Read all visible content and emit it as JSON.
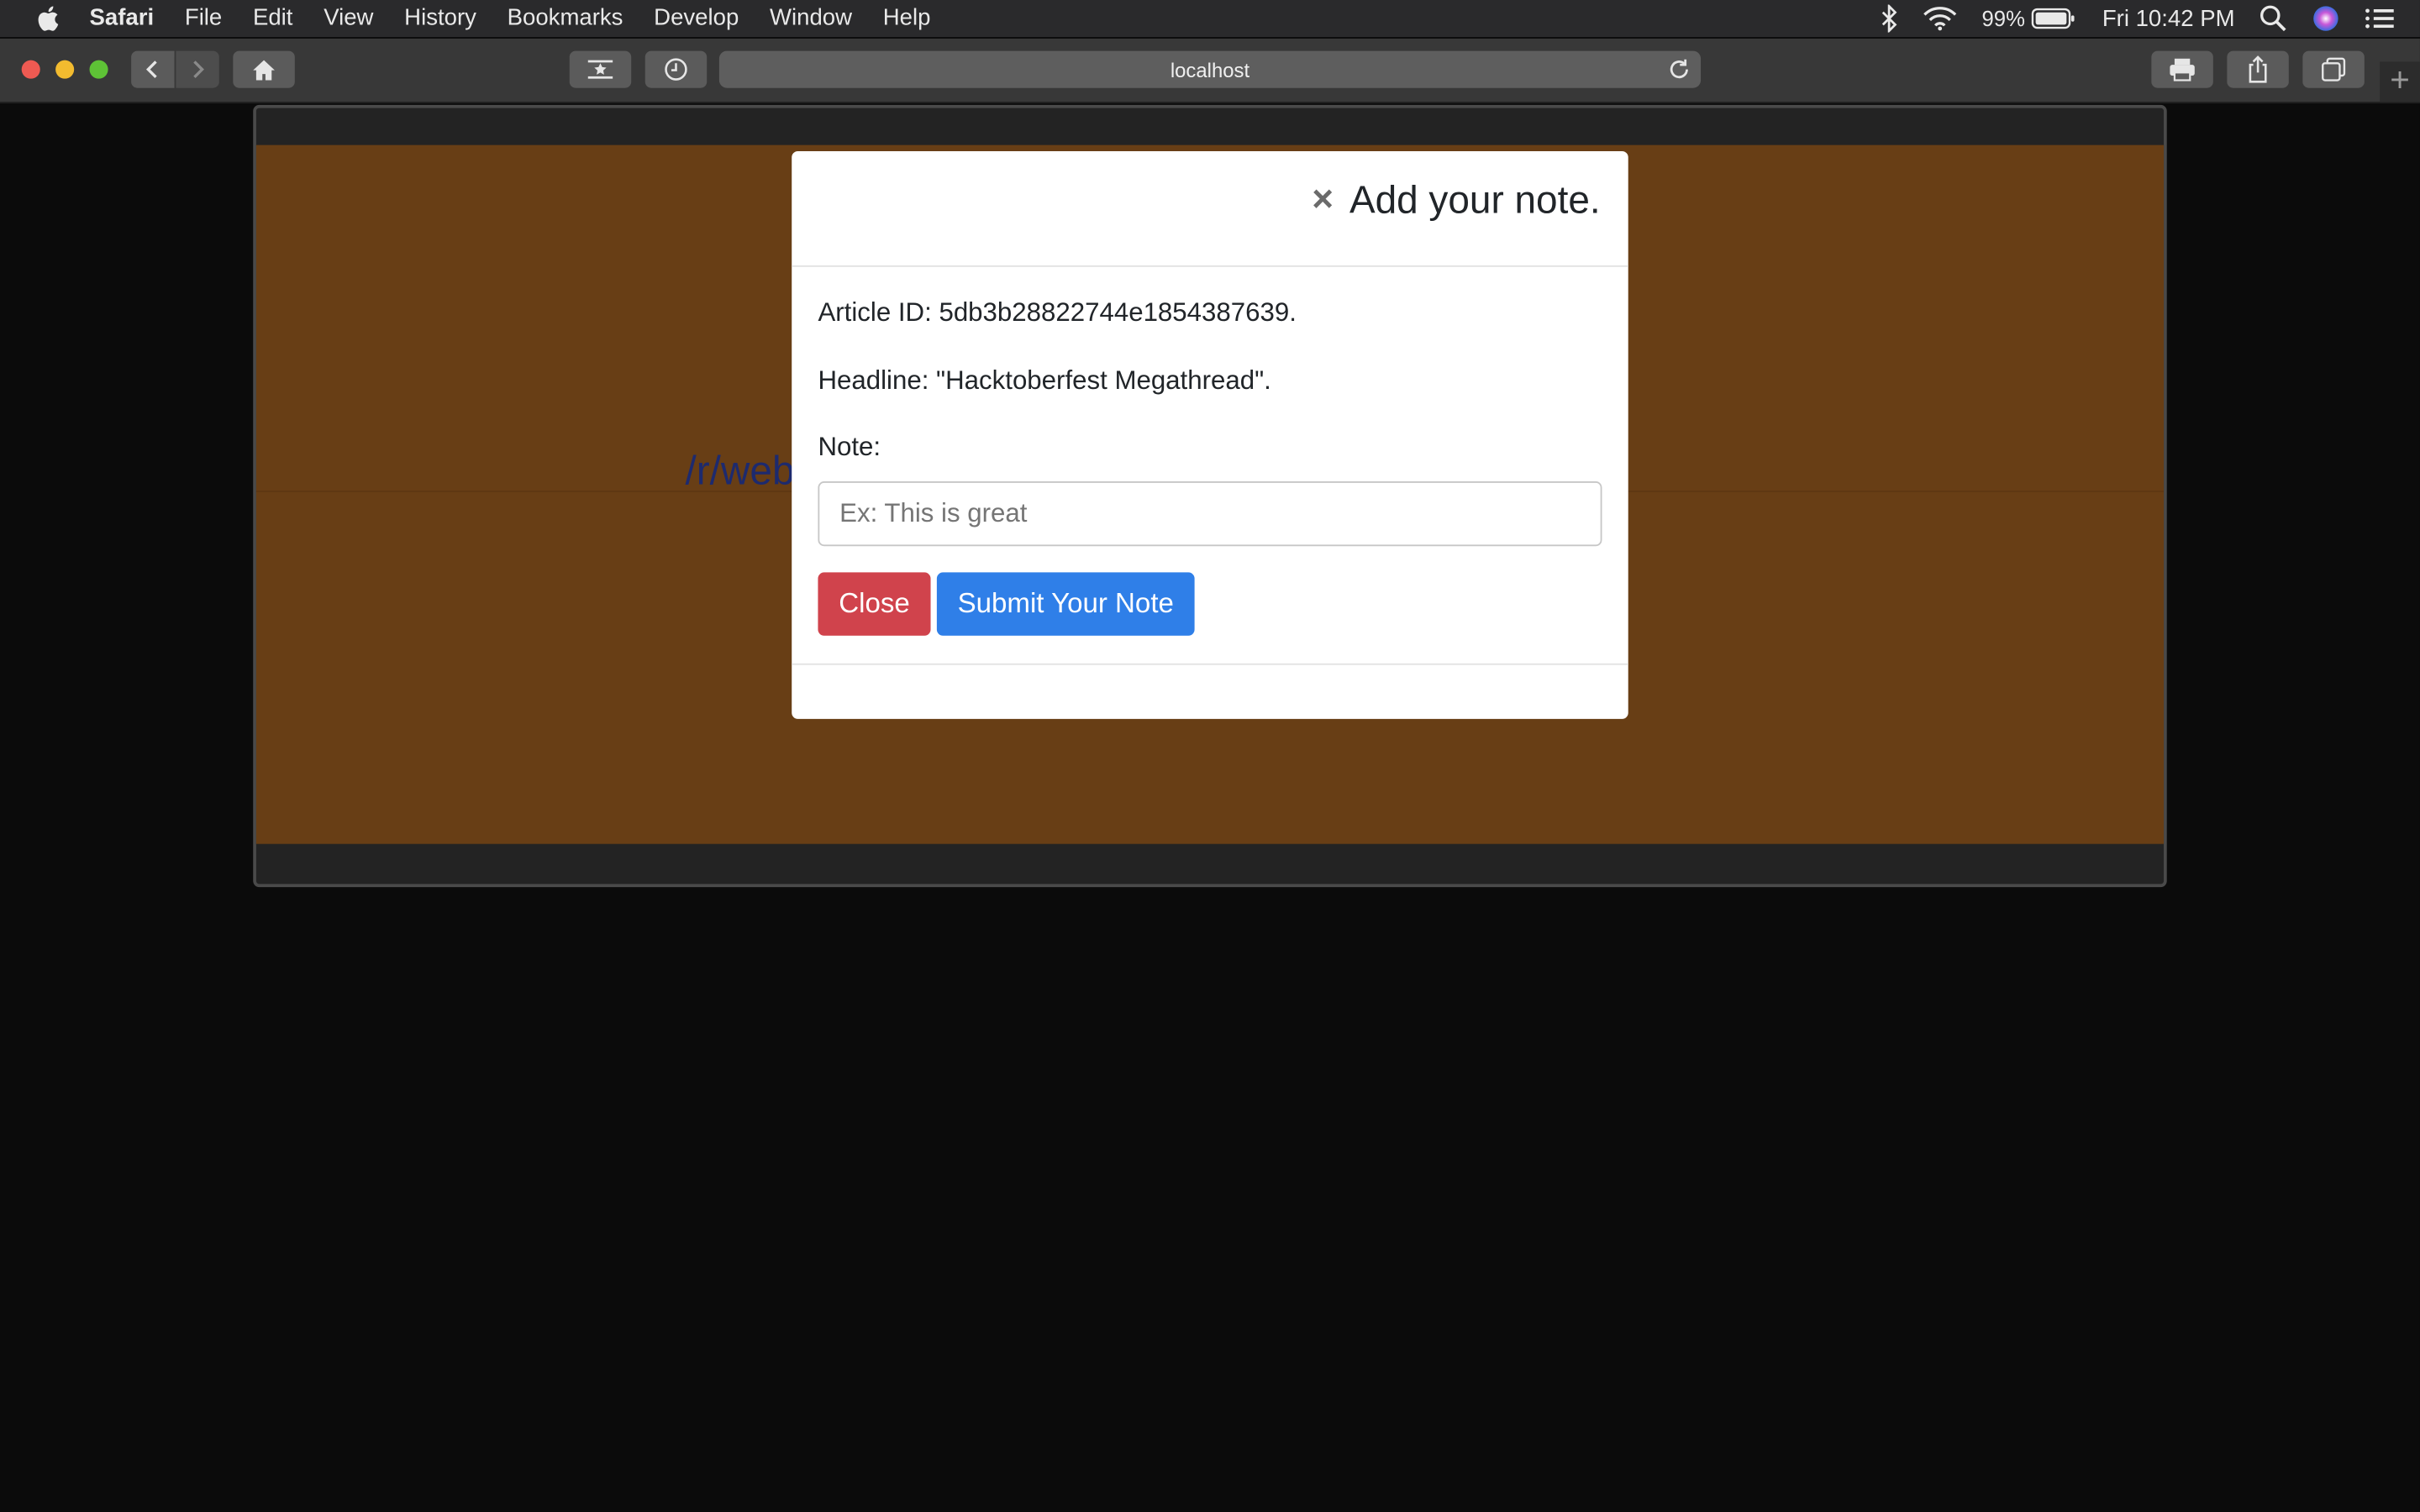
{
  "menubar": {
    "app_name": "Safari",
    "items": [
      "File",
      "Edit",
      "View",
      "History",
      "Bookmarks",
      "Develop",
      "Window",
      "Help"
    ],
    "battery": "99%",
    "clock": "Fri 10:42 PM"
  },
  "browser": {
    "url": "localhost",
    "new_tab": "+"
  },
  "page": {
    "link_text": "/r/webdev: Hacktoberfest Megathread/",
    "band_color": "#683e15"
  },
  "modal": {
    "close_glyph": "×",
    "title": "Add your note.",
    "article_id": "Article ID: 5db3b28822744e1854387639.",
    "headline": "Headline: \"Hacktoberfest Megathread\".",
    "note_label": "Note:",
    "note_placeholder": "Ex: This is great",
    "close_button": "Close",
    "submit_button": "Submit Your Note"
  },
  "colors": {
    "close_button": "#d0434c",
    "submit_button": "#2f7fe8"
  }
}
